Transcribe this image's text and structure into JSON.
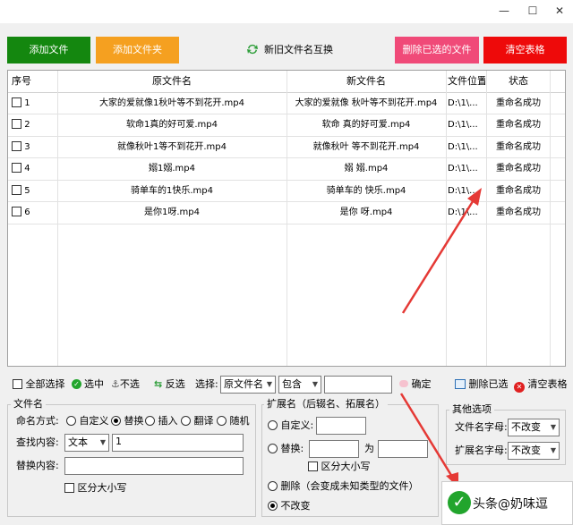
{
  "window": {
    "minimize": "—",
    "maximize": "☐",
    "close": "✕"
  },
  "toolbar": {
    "add_file": {
      "label": "添加文件",
      "color": "#14870f"
    },
    "add_folder": {
      "label": "添加文件夹",
      "color": "#f5a020"
    },
    "swap": "新旧文件名互换",
    "delete_selected": {
      "label": "删除已选的文件",
      "color": "#f04a78"
    },
    "clear_table": {
      "label": "清空表格",
      "color": "#ee0a0a"
    }
  },
  "table": {
    "headers": [
      "序号",
      "原文件名",
      "新文件名",
      "文件位置",
      "状态"
    ],
    "rows": [
      {
        "no": "1",
        "original": "大家的爱就像1秋叶等不到花开.mp4",
        "new": "大家的爱就像  秋叶等不到花开.mp4",
        "location": "D:\\1\\...",
        "status": "重命名成功"
      },
      {
        "no": "2",
        "original": "软命1真的好可爱.mp4",
        "new": "软命  真的好可爱.mp4",
        "location": "D:\\1\\...",
        "status": "重命名成功"
      },
      {
        "no": "3",
        "original": "就像秋叶1等不到花开.mp4",
        "new": "就像秋叶  等不到花开.mp4",
        "location": "D:\\1\\...",
        "status": "重命名成功"
      },
      {
        "no": "4",
        "original": "嫋1嫋.mp4",
        "new": "嫋  嫋.mp4",
        "location": "D:\\1\\...",
        "status": "重命名成功"
      },
      {
        "no": "5",
        "original": "骑单车的1快乐.mp4",
        "new": "骑单车的  快乐.mp4",
        "location": "D:\\1\\...",
        "status": "重命名成功"
      },
      {
        "no": "6",
        "original": "是你1呀.mp4",
        "new": "是你  呀.mp4",
        "location": "D:\\1\\...",
        "status": "重命名成功"
      }
    ]
  },
  "selection_bar": {
    "select_all": "全部选择",
    "select": "选中",
    "deselect": "不选",
    "invert": "反选",
    "choose_label": "选择:",
    "field_select": "原文件名",
    "match_select": "包含",
    "confirm": "确定",
    "delete_selected": "删除已选",
    "clear_table": "清空表格"
  },
  "filename_group": {
    "title": "文件名",
    "mode_label": "命名方式:",
    "modes": [
      "自定义",
      "替换",
      "插入",
      "翻译",
      "随机"
    ],
    "find_label": "查找内容:",
    "find_type": "文本",
    "find_value": "1",
    "replace_label": "替换内容:",
    "replace_value": "",
    "case_sensitive": "区分大小写"
  },
  "extension_group": {
    "title": "扩展名（后辍名、拓展名）",
    "custom": "自定义:",
    "replace": "替换:",
    "to": "为",
    "case_sensitive": "区分大小写",
    "delete": "删除（会变成未知类型的文件）",
    "keep": "不改变"
  },
  "other_group": {
    "title": "其他选项",
    "filename_case_label": "文件名字母:",
    "filename_case_value": "不改变",
    "ext_case_label": "扩展名字母:",
    "ext_case_value": "不改变"
  },
  "watermark": {
    "text": "头条@奶味逗"
  }
}
